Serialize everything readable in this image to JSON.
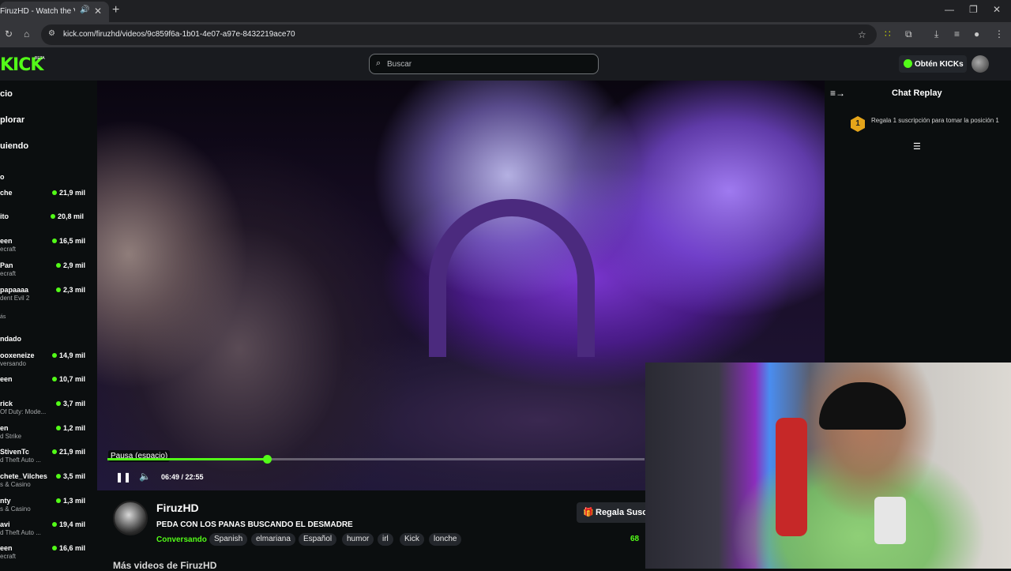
{
  "browser": {
    "tab_title": "FiruzHD - Watch the VOD o",
    "url": "kick.com/firuzhd/videos/9c859f6a-1b01-4e07-a97e-8432219ace70"
  },
  "header": {
    "logo": "KICK",
    "logo_badge": "BETA",
    "search_placeholder": "Buscar",
    "kicks_button": "Obtén KICKs"
  },
  "sidebar": {
    "nav": [
      "cio",
      "plorar",
      "uiendo"
    ],
    "sections": [
      "o",
      "ndado"
    ],
    "group1": [
      {
        "name": "che",
        "category": "",
        "viewers": "21,9 mil"
      },
      {
        "name": "ito",
        "category": "",
        "viewers": "20,8 mil"
      },
      {
        "name": "een",
        "category": "ecraft",
        "viewers": "16,5 mil"
      },
      {
        "name": "Pan",
        "category": "ecraft",
        "viewers": "2,9 mil"
      },
      {
        "name": "papaaaa",
        "category": "dent Evil 2",
        "viewers": "2,3 mil"
      }
    ],
    "more1": "ás",
    "group2": [
      {
        "name": "ooxeneize",
        "category": "versando",
        "viewers": "14,9 mil"
      },
      {
        "name": "een",
        "category": "",
        "viewers": "10,7 mil"
      },
      {
        "name": "rick",
        "category": "Of Duty: Mode...",
        "viewers": "3,7 mil"
      },
      {
        "name": "en",
        "category": "d Strike",
        "viewers": "1,2 mil"
      },
      {
        "name": "StivenTc",
        "category": "d Theft Auto ...",
        "viewers": "21,9 mil"
      },
      {
        "name": "chete_Vilches",
        "category": "s & Casino",
        "viewers": "3,5 mil"
      },
      {
        "name": "nty",
        "category": "s & Casino",
        "viewers": "1,3 mil"
      },
      {
        "name": "avi",
        "category": "d Theft Auto ...",
        "viewers": "19,4 mil"
      },
      {
        "name": "een",
        "category": "ecraft",
        "viewers": "16,6 mil"
      }
    ]
  },
  "player": {
    "tooltip": "Pausa (espacio)",
    "time": "06:49 / 22:55",
    "progress": 0.297
  },
  "video_info": {
    "channel": "FiruzHD",
    "title": "PEDA CON LOS PANAS BUSCANDO EL DESMADRE",
    "category": "Conversando",
    "tags": [
      "Spanish",
      "elmariana",
      "Español",
      "humor",
      "irl",
      "Kick",
      "lonche"
    ],
    "subscribe_button": "Regala Susc",
    "viewers": "68",
    "more_videos": "Más videos de FiruzHD"
  },
  "chat": {
    "title": "Chat Replay",
    "gift_rank": "1",
    "gift_text": "Regala 1 suscripción para tomar la posición 1"
  },
  "colors": {
    "accent": "#53fc18",
    "background": "#0b0e0f"
  }
}
